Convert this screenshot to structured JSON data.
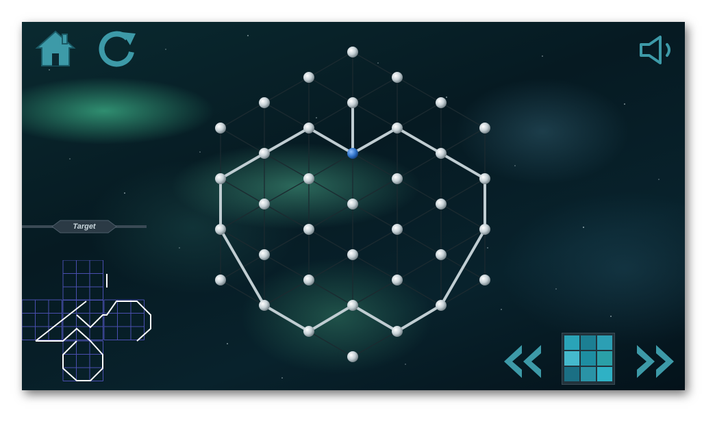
{
  "toolbar": {
    "home_icon": "home-icon",
    "restart_icon": "restart-icon",
    "sound_icon": "speaker-icon"
  },
  "target_panel": {
    "label": "Target"
  },
  "navigation": {
    "prev_icon": "double-chevron-left-icon",
    "level_menu_icon": "level-grid-icon",
    "next_icon": "double-chevron-right-icon"
  },
  "colors": {
    "accent": "#3d9aa8",
    "node": "#c6d1d6",
    "selected_node": "#2f73c9",
    "drawn_line": "#c0cdd2",
    "grid_line": "#1b2a30",
    "target_grid": "#4a4fb0",
    "target_path": "#ffffff",
    "level_tiles": [
      "#2aa4b8",
      "#1c7f93",
      "#2c9fb4",
      "#45b9cc",
      "#1e8ea2",
      "#2aa0a8",
      "#1b6f84",
      "#2a93a6",
      "#2fb1c5"
    ]
  },
  "board": {
    "selected_node": "n7",
    "drawn_edges": 14
  }
}
